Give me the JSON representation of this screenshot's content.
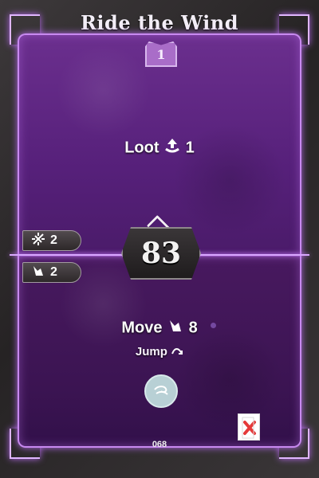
{
  "card": {
    "title": "Ride the Wind",
    "level": "1",
    "initiative": "83",
    "number": "068"
  },
  "stats": [
    {
      "icon": "spark-icon",
      "value": "2"
    },
    {
      "icon": "boot-icon",
      "value": "2"
    }
  ],
  "top_action": {
    "label": "Loot",
    "value": "1",
    "icon": "loot-icon"
  },
  "bottom_action": {
    "label": "Move",
    "value": "8",
    "icon": "move-icon",
    "modifier_label": "Jump",
    "modifier_icon": "jump-icon",
    "element_icon": "wind-element-icon",
    "loss_icon": "loss-icon"
  },
  "colors": {
    "panel_top": "#6b2f8e",
    "panel_bottom": "#3b1452",
    "accent": "#d9a8ff",
    "frame": "#262324"
  }
}
